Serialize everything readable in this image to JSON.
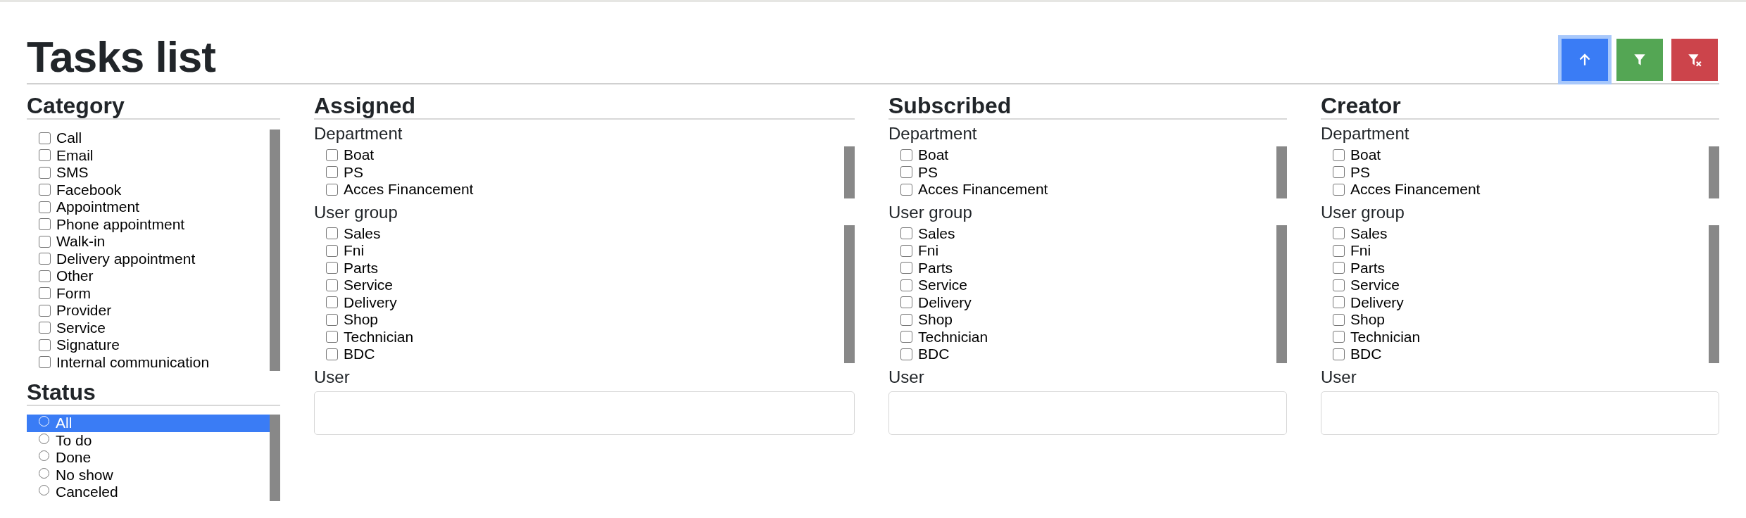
{
  "page": {
    "title": "Tasks list"
  },
  "toolbar": {
    "buttons": [
      {
        "kind": "sort-up",
        "focused": true
      },
      {
        "kind": "filter",
        "focused": false
      },
      {
        "kind": "clear-filter",
        "focused": false
      }
    ]
  },
  "category": {
    "heading": "Category",
    "options": [
      {
        "label": "Call",
        "checked": false
      },
      {
        "label": "Email",
        "checked": false
      },
      {
        "label": "SMS",
        "checked": false
      },
      {
        "label": "Facebook",
        "checked": false
      },
      {
        "label": "Appointment",
        "checked": false
      },
      {
        "label": "Phone appointment",
        "checked": false
      },
      {
        "label": "Walk-in",
        "checked": false
      },
      {
        "label": "Delivery appointment",
        "checked": false
      },
      {
        "label": "Other",
        "checked": false
      },
      {
        "label": "Form",
        "checked": false
      },
      {
        "label": "Provider",
        "checked": false
      },
      {
        "label": "Service",
        "checked": false
      },
      {
        "label": "Signature",
        "checked": false
      },
      {
        "label": "Internal communication",
        "checked": false
      }
    ]
  },
  "status": {
    "heading": "Status",
    "options": [
      {
        "label": "All",
        "selected": true
      },
      {
        "label": "To do",
        "selected": false
      },
      {
        "label": "Done",
        "selected": false
      },
      {
        "label": "No show",
        "selected": false
      },
      {
        "label": "Canceled",
        "selected": false
      }
    ]
  },
  "groups": [
    {
      "heading": "Assigned",
      "department": {
        "label": "Department",
        "options": [
          {
            "label": "Boat",
            "checked": false
          },
          {
            "label": "PS",
            "checked": false
          },
          {
            "label": "Acces Financement",
            "checked": false
          }
        ]
      },
      "user_group": {
        "label": "User group",
        "options": [
          {
            "label": "Sales",
            "checked": false
          },
          {
            "label": "Fni",
            "checked": false
          },
          {
            "label": "Parts",
            "checked": false
          },
          {
            "label": "Service",
            "checked": false
          },
          {
            "label": "Delivery",
            "checked": false
          },
          {
            "label": "Shop",
            "checked": false
          },
          {
            "label": "Technician",
            "checked": false
          },
          {
            "label": "BDC",
            "checked": false
          }
        ]
      },
      "user": {
        "label": "User"
      }
    },
    {
      "heading": "Subscribed",
      "department": {
        "label": "Department",
        "options": [
          {
            "label": "Boat",
            "checked": false
          },
          {
            "label": "PS",
            "checked": false
          },
          {
            "label": "Acces Financement",
            "checked": false
          }
        ]
      },
      "user_group": {
        "label": "User group",
        "options": [
          {
            "label": "Sales",
            "checked": false
          },
          {
            "label": "Fni",
            "checked": false
          },
          {
            "label": "Parts",
            "checked": false
          },
          {
            "label": "Service",
            "checked": false
          },
          {
            "label": "Delivery",
            "checked": false
          },
          {
            "label": "Shop",
            "checked": false
          },
          {
            "label": "Technician",
            "checked": false
          },
          {
            "label": "BDC",
            "checked": false
          }
        ]
      },
      "user": {
        "label": "User"
      }
    },
    {
      "heading": "Creator",
      "department": {
        "label": "Department",
        "options": [
          {
            "label": "Boat",
            "checked": false
          },
          {
            "label": "PS",
            "checked": false
          },
          {
            "label": "Acces Financement",
            "checked": false
          }
        ]
      },
      "user_group": {
        "label": "User group",
        "options": [
          {
            "label": "Sales",
            "checked": false
          },
          {
            "label": "Fni",
            "checked": false
          },
          {
            "label": "Parts",
            "checked": false
          },
          {
            "label": "Service",
            "checked": false
          },
          {
            "label": "Delivery",
            "checked": false
          },
          {
            "label": "Shop",
            "checked": false
          },
          {
            "label": "Technician",
            "checked": false
          },
          {
            "label": "BDC",
            "checked": false
          }
        ]
      },
      "user": {
        "label": "User"
      }
    }
  ]
}
